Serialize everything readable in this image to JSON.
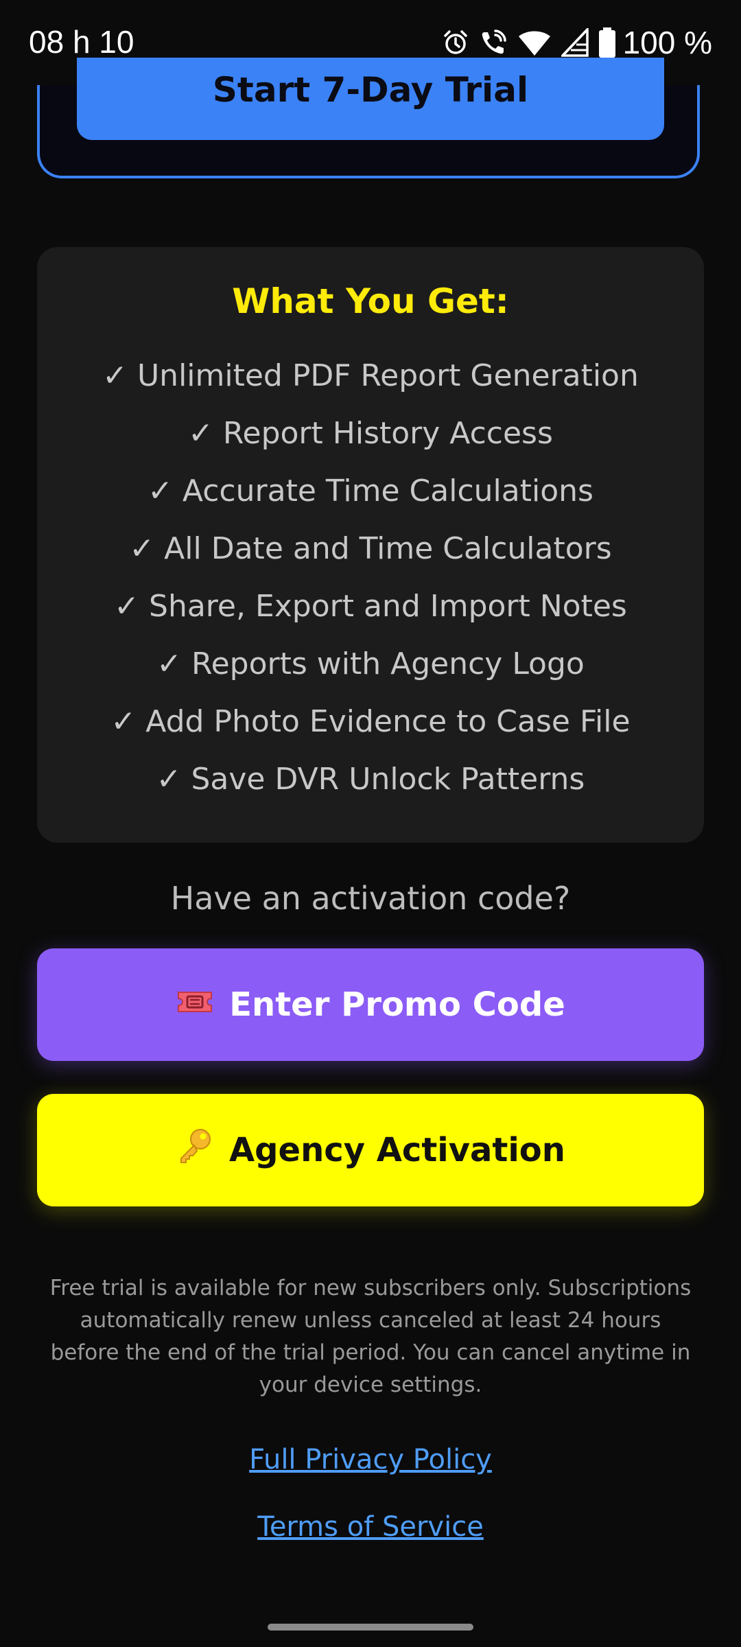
{
  "status_bar": {
    "time": "08 h 10",
    "battery": "100 %",
    "icons": [
      "alarm-icon",
      "wifi-call-icon",
      "wifi-icon",
      "signal-icon",
      "battery-icon"
    ]
  },
  "trial": {
    "button_label": "Start 7-Day Trial"
  },
  "features": {
    "title": "What You Get:",
    "items": [
      "✓ Unlimited PDF Report Generation",
      "✓ Report History Access",
      "✓ Accurate Time Calculations",
      "✓ All Date and Time Calculators",
      "✓ Share, Export and Import Notes",
      "✓ Reports with Agency Logo",
      "✓ Add Photo Evidence to Case File",
      "✓ Save DVR Unlock Patterns"
    ]
  },
  "activation": {
    "question": "Have an activation code?",
    "promo_label": "Enter Promo Code",
    "agency_label": "Agency Activation"
  },
  "disclaimer": "Free trial is available for new subscribers only. Subscriptions automatically renew unless canceled at least 24 hours before the end of the trial period. You can cancel anytime in your device settings.",
  "links": {
    "privacy": "Full Privacy Policy",
    "terms": "Terms of Service"
  },
  "colors": {
    "accent_blue": "#3b82f6",
    "promo_purple": "#8b5cf6",
    "agency_yellow": "#ffff00",
    "title_yellow": "#ffeb0a",
    "link_blue": "#4f9df8"
  }
}
